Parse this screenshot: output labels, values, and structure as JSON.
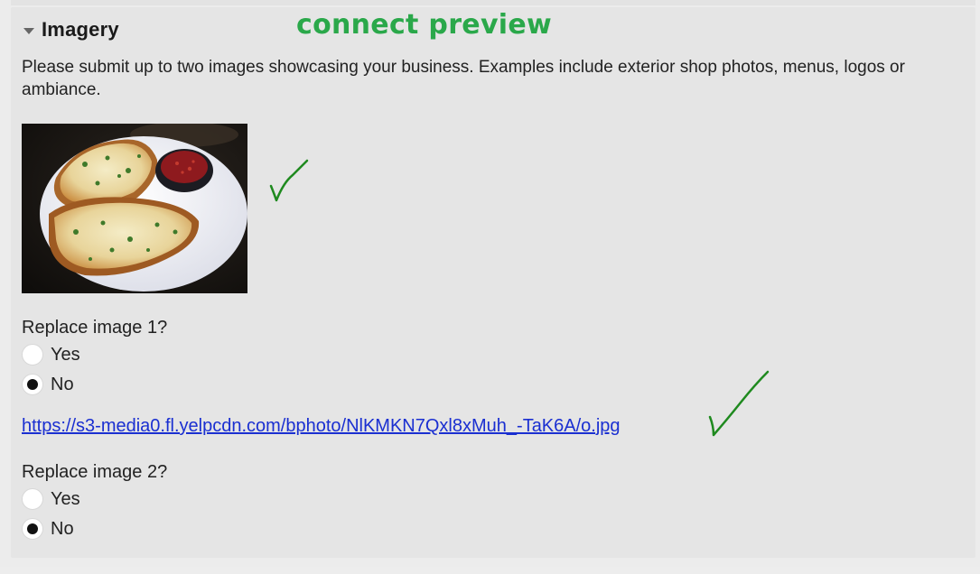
{
  "section": {
    "title": "Imagery",
    "annotation": "connect preview",
    "description": "Please submit up to two images showcasing your business. Examples include exterior shop photos, menus, logos or ambiance."
  },
  "image_1": {
    "question": "Replace image 1?",
    "options": [
      {
        "label": "Yes",
        "selected": false
      },
      {
        "label": "No",
        "selected": true
      }
    ],
    "url": "https://s3-media0.fl.yelpcdn.com/bphoto/NlKMKN7Qxl8xMuh_-TaK6A/o.jpg"
  },
  "image_2": {
    "question": "Replace image 2?",
    "options": [
      {
        "label": "Yes",
        "selected": false
      },
      {
        "label": "No",
        "selected": true
      }
    ]
  },
  "colors": {
    "annotation_green": "#2aa84a",
    "check_green": "#1f8a1f",
    "link_blue": "#1a2fd1",
    "panel_bg": "#e5e5e5"
  }
}
